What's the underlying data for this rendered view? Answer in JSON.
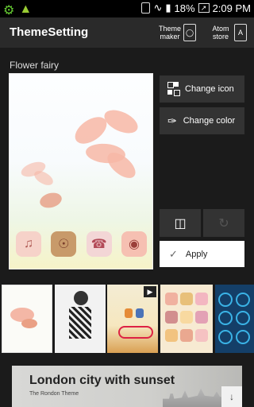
{
  "status_bar": {
    "battery": "18%",
    "time": "2:09 PM"
  },
  "header": {
    "title": "ThemeSetting",
    "theme_maker": "Theme maker",
    "atom_store": "Atom store"
  },
  "theme_name": "Flower fairy",
  "actions": {
    "change_icon": "Change icon",
    "change_color": "Change color",
    "apply": "Apply"
  },
  "banner": {
    "title": "London city with sunset",
    "subtitle": "The Rondon Theme"
  },
  "icons": {
    "usb": "usb-icon",
    "android": "android-icon",
    "sim": "sim-icon",
    "wifi": "wifi-icon",
    "signal": "signal-icon",
    "battery": "battery-icon",
    "chart": "chart-icon",
    "change_icon": "grid-icon",
    "change_color": "eyedropper-icon",
    "delete": "trash-icon",
    "undo": "undo-icon",
    "check": "check-icon",
    "play": "play-icon",
    "download": "download-icon"
  }
}
